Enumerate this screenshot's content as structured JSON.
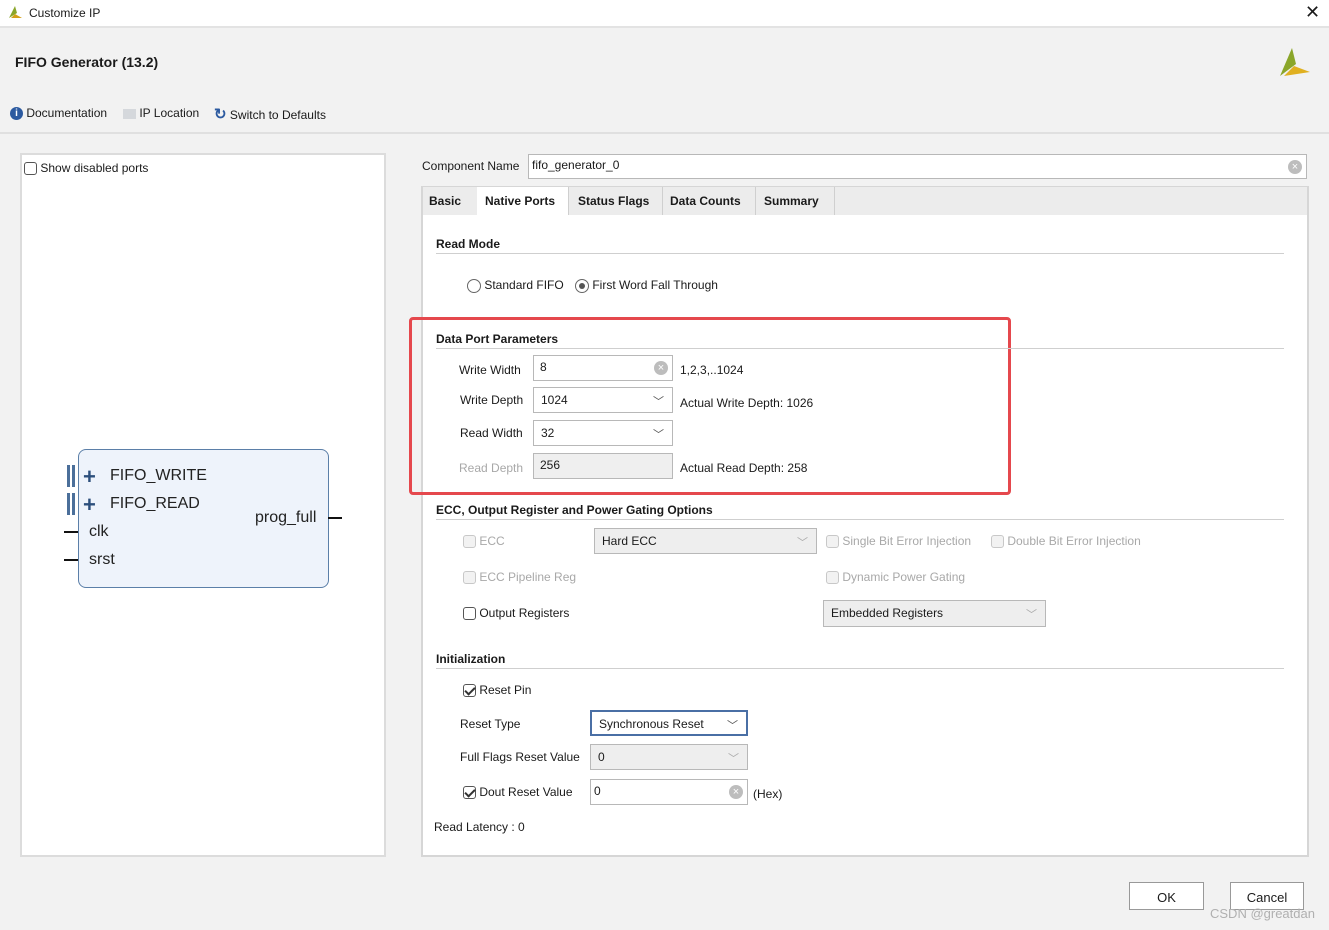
{
  "window": {
    "title": "Customize IP",
    "close_icon": "close-icon"
  },
  "header": {
    "title": "FIFO Generator (13.2)",
    "toolbar": {
      "documentation": "Documentation",
      "ip_location": "IP Location",
      "switch_defaults": "Switch to Defaults"
    }
  },
  "left": {
    "show_disabled_ports": "Show disabled ports",
    "ports_left": [
      "FIFO_WRITE",
      "FIFO_READ",
      "clk",
      "srst"
    ],
    "ports_right": [
      "prog_full"
    ]
  },
  "component": {
    "label": "Component Name",
    "value": "fifo_generator_0"
  },
  "tabs": [
    "Basic",
    "Native Ports",
    "Status Flags",
    "Data Counts",
    "Summary"
  ],
  "active_tab": "Native Ports",
  "read_mode": {
    "title": "Read Mode",
    "options": [
      "Standard FIFO",
      "First Word Fall Through"
    ],
    "selected": "First Word Fall Through"
  },
  "data_port": {
    "title": "Data Port Parameters",
    "write_width_label": "Write Width",
    "write_width": "8",
    "write_width_range": "1,2,3,..1024",
    "write_depth_label": "Write Depth",
    "write_depth": "1024",
    "actual_write_depth": "Actual Write Depth: 1026",
    "read_width_label": "Read Width",
    "read_width": "32",
    "read_depth_label": "Read Depth",
    "read_depth": "256",
    "actual_read_depth": "Actual Read Depth: 258"
  },
  "ecc": {
    "title": "ECC, Output Register and Power Gating Options",
    "ecc": "ECC",
    "ecc_type": "Hard ECC",
    "single_bit": "Single Bit Error Injection",
    "double_bit": "Double Bit Error Injection",
    "ecc_pipeline": "ECC Pipeline Reg",
    "dynamic_power": "Dynamic Power Gating",
    "output_registers": "Output Registers",
    "register_type": "Embedded Registers"
  },
  "init": {
    "title": "Initialization",
    "reset_pin": "Reset Pin",
    "reset_type_label": "Reset Type",
    "reset_type": "Synchronous Reset",
    "full_flags_label": "Full Flags Reset Value",
    "full_flags": "0",
    "dout_reset_label": "Dout Reset Value",
    "dout_reset": "0",
    "hex": "(Hex)",
    "read_latency": "Read Latency : 0"
  },
  "footer": {
    "ok": "OK",
    "cancel": "Cancel",
    "watermark": "CSDN @greatdan"
  },
  "colors": {
    "highlight": "#e5484d",
    "accent": "#4a6fa5"
  }
}
